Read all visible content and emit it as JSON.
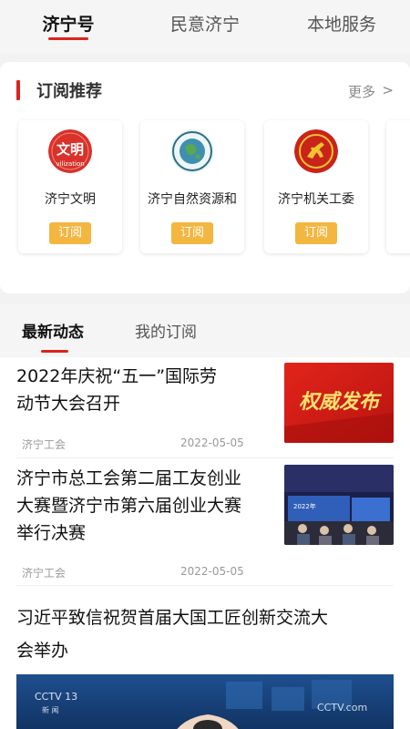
{
  "top_tabs": [
    {
      "label": "济宁号",
      "active": true
    },
    {
      "label": "民意济宁",
      "active": false
    },
    {
      "label": "本地服务",
      "active": false
    }
  ],
  "recommend": {
    "title": "订阅推荐",
    "more": "更多",
    "more_arrow": ">",
    "accounts": [
      {
        "name": "济宁文明",
        "button": "订阅",
        "logo_text": "文明",
        "logo_sub": "vilization"
      },
      {
        "name": "济宁自然资源和",
        "button": "订阅"
      },
      {
        "name": "济宁机关工委",
        "button": "订阅"
      }
    ]
  },
  "news_tabs": [
    {
      "label": "最新动态",
      "active": true
    },
    {
      "label": "我的订阅",
      "active": false
    }
  ],
  "news": [
    {
      "title_line1": "2022年庆祝“五一”国际劳",
      "title_line2": "动节大会召开",
      "source": "济宁工会",
      "date": "2022-05-05",
      "thumb_text": "权威发布"
    },
    {
      "title_line1": "济宁市总工会第二届工友创业",
      "title_line2": "大赛暨济宁市第六届创业大赛",
      "title_line3": "举行决赛",
      "source": "济宁工会",
      "date": "2022-05-05",
      "thumb_text": "2022年"
    },
    {
      "title_line1": "习近平致信祝贺首届大国工匠创新交流大",
      "title_line2": "会举办",
      "video_logo_left": "CCTV 13",
      "video_logo_left_sub": "新 闻",
      "video_logo_right": "CCTV.com"
    }
  ],
  "colors": {
    "accent_red": "#d9251d",
    "subscribe_yellow": "#f3b640"
  }
}
